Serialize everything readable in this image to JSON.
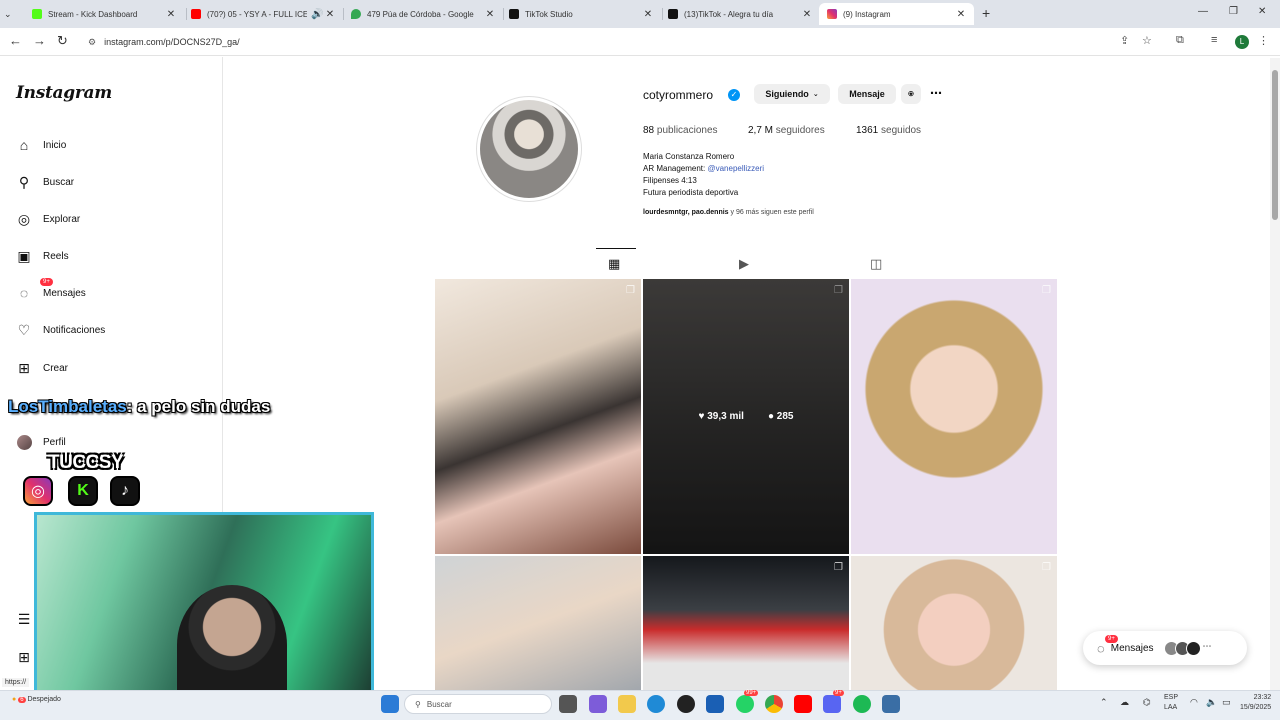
{
  "browser": {
    "tabs": [
      {
        "title": "Stream - Kick Dashboard",
        "color": "#53fc18"
      },
      {
        "title": "(70?) 05 - YSY A - FULL ICE",
        "color": "#ff0000"
      },
      {
        "title": "479 Púa de Córdoba - Google",
        "color": "#34a853"
      },
      {
        "title": "TikTok Studio",
        "color": "#111111"
      },
      {
        "title": "(13)TikTok - Alegra tu día",
        "color": "#111111"
      },
      {
        "title": "(9) Instagram",
        "color": "#e1306c"
      }
    ],
    "url": "instagram.com/p/DOCNS27D_ga/",
    "profile_initial": "L",
    "status_url": "https://"
  },
  "sidebar": {
    "logo": "Instagram",
    "items": [
      {
        "label": "Inicio",
        "icon": "home-icon"
      },
      {
        "label": "Buscar",
        "icon": "search-icon"
      },
      {
        "label": "Explorar",
        "icon": "compass-icon"
      },
      {
        "label": "Reels",
        "icon": "reels-icon"
      },
      {
        "label": "Mensajes",
        "icon": "messenger-icon",
        "badge": "9+"
      },
      {
        "label": "Notificaciones",
        "icon": "heart-icon"
      },
      {
        "label": "Crear",
        "icon": "plus-icon"
      },
      {
        "label": "Perfil",
        "icon": "avatar"
      }
    ]
  },
  "profile": {
    "username": "cotyrommero",
    "follow_btn": "Siguiendo",
    "message_btn": "Mensaje",
    "posts_count": "88",
    "posts_label": "publicaciones",
    "followers_count": "2,7 M",
    "followers_label": "seguidores",
    "following_count": "1361",
    "following_label": "seguidos",
    "full_name": "Maria Constanza Romero",
    "bio_line1_prefix": "AR Management: ",
    "bio_line1_link": "@vanepellizzeri",
    "bio_line2": "Filipenses 4:13",
    "bio_line3": "Futura periodista deportiva",
    "followed_by_names": "lourdesmntgr, pao.dennis",
    "followed_by_rest": " y 96 más siguen este perfil"
  },
  "posts": {
    "hover_likes": "39,3 mil",
    "hover_comments": "285"
  },
  "stream": {
    "chat_user": "LosTimbaletas",
    "chat_message": ": a pelo sin dudas",
    "streamer": "TUCCSY"
  },
  "messages_pill": {
    "label": "Mensajes",
    "badge": "9+"
  },
  "taskbar": {
    "weather": "Despejado",
    "search_placeholder": "Buscar",
    "lang_top": "ESP",
    "lang_bottom": "LAA",
    "time": "23:32",
    "date": "15/9/2025",
    "weather_badge": "6",
    "app_badge": "99+",
    "app_badge2": "9+"
  }
}
